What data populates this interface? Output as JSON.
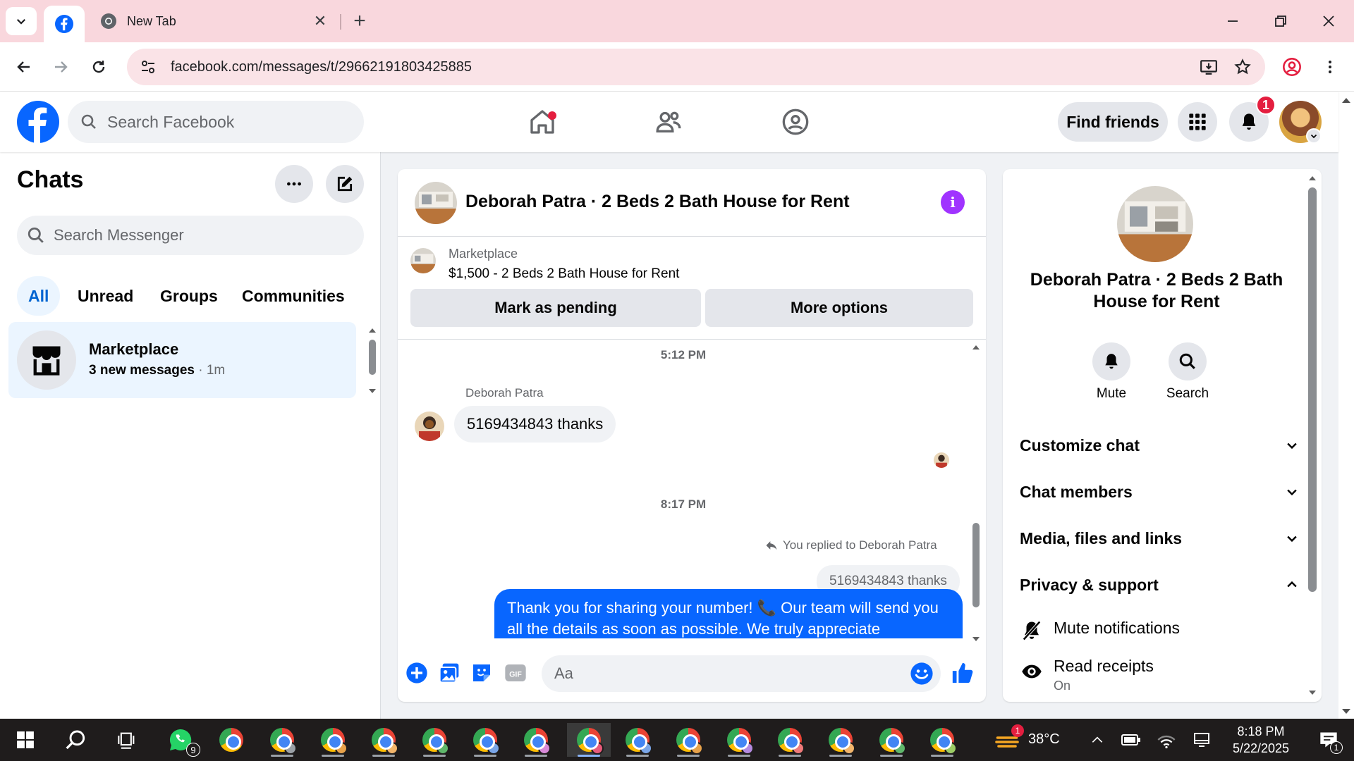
{
  "browser": {
    "tabs": [
      {
        "title": "",
        "icon": "facebook-icon",
        "active": true
      },
      {
        "title": "New Tab",
        "icon": "chrome-icon",
        "active": false
      }
    ],
    "close_glyph": "✕",
    "new_tab_glyph": "+",
    "url": "facebook.com/messages/t/29662191803425885"
  },
  "header": {
    "search_placeholder": "Search Facebook",
    "find_friends_label": "Find friends",
    "notification_count": "1"
  },
  "sidebar": {
    "title": "Chats",
    "search_placeholder": "Search Messenger",
    "filters": [
      "All",
      "Unread",
      "Groups",
      "Communities"
    ],
    "active_filter": "All",
    "chats": [
      {
        "name": "Marketplace",
        "preview_bold": "3 new messages",
        "time": " · 1m"
      }
    ]
  },
  "conversation": {
    "title": "Deborah Patra · 2 Beds 2 Bath House for Rent",
    "marketplace_label": "Marketplace",
    "listing": "$1,500 - 2 Beds 2 Bath House for Rent",
    "mark_pending_label": "Mark as pending",
    "more_options_label": "More options",
    "time_1": "5:12 PM",
    "sender_name": "Deborah Patra",
    "incoming_message": "5169434843 thanks",
    "time_2": "8:17 PM",
    "replied_note": "You replied to Deborah Patra",
    "quoted_message": "5169434843 thanks",
    "outgoing_message": "Thank you for sharing your number! 📞 Our team will send you all the details as soon as possible. We truly appreciate",
    "composer_placeholder": "Aa"
  },
  "info_panel": {
    "name": "Deborah Patra · 2 Beds 2 Bath House for Rent",
    "actions": [
      {
        "label": "Mute",
        "icon": "bell-icon"
      },
      {
        "label": "Search",
        "icon": "search-icon"
      }
    ],
    "sections": [
      {
        "label": "Customize chat",
        "expanded": false
      },
      {
        "label": "Chat members",
        "expanded": false
      },
      {
        "label": "Media, files and links",
        "expanded": false
      },
      {
        "label": "Privacy & support",
        "expanded": true
      }
    ],
    "privacy_items": [
      {
        "label": "Mute notifications",
        "sub": "",
        "icon": "bell-off-icon"
      },
      {
        "label": "Read receipts",
        "sub": "On",
        "icon": "eye-icon"
      }
    ]
  },
  "taskbar": {
    "whatsapp_badge": "9",
    "weather_badge": "1",
    "temperature": "38°C",
    "time": "8:18 PM",
    "date": "5/22/2025",
    "notification_count": "1"
  },
  "colors": {
    "facebook_blue": "#0866ff",
    "messenger_purple": "#a033ff",
    "notification_red": "#e41e3f",
    "chrome_tab_strip": "#f9d7dd"
  }
}
